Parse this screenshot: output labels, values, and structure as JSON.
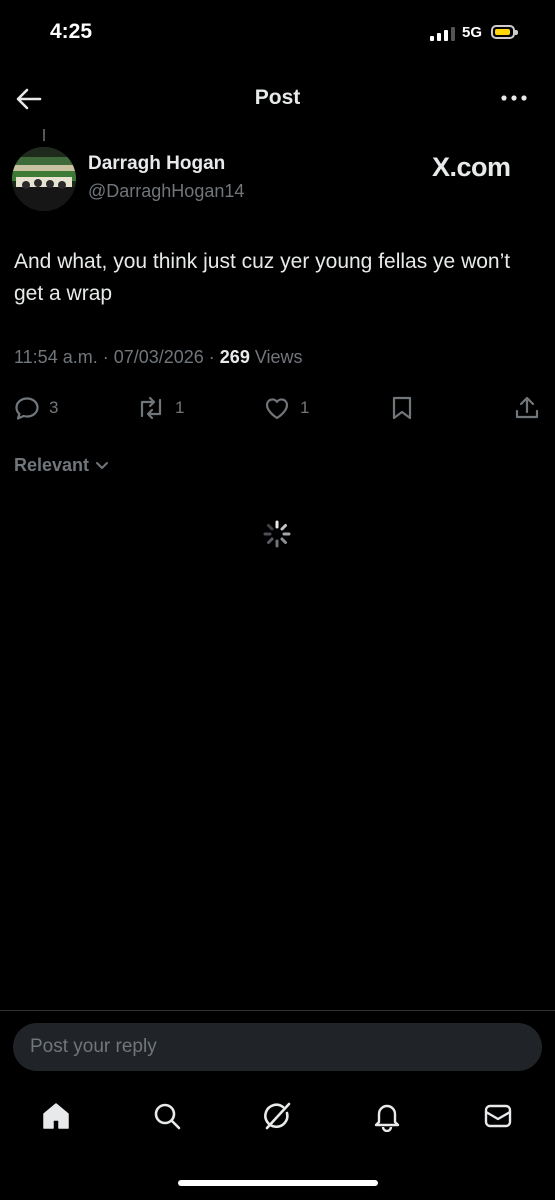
{
  "status_bar": {
    "time": "4:25",
    "network": "5G"
  },
  "header": {
    "title": "Post"
  },
  "post": {
    "author_name": "Darragh Hogan",
    "author_handle": "@DarraghHogan14",
    "watermark": "X.com",
    "text": "And what, you think just cuz yer young fellas ye won’t get a wrap",
    "timestamp": "11:54 a.m. · 07/03/2026 · ",
    "views_count": "269",
    "views_label": " Views",
    "replies": "3",
    "reposts": "1",
    "likes": "1"
  },
  "sort": {
    "label": "Relevant"
  },
  "reply_box": {
    "placeholder": "Post your reply"
  },
  "colors": {
    "background": "#000000",
    "text": "#e7e9ea",
    "muted": "#71767b",
    "battery": "#ffd60a"
  },
  "icons": {
    "back": "arrow-left-icon",
    "more": "more-horizontal-icon",
    "reply": "comment-icon",
    "repost": "repost-icon",
    "like": "heart-icon",
    "bookmark": "bookmark-icon",
    "share": "share-icon",
    "nav": [
      "home-icon",
      "search-icon",
      "grok-icon",
      "bell-icon",
      "mail-icon"
    ]
  }
}
